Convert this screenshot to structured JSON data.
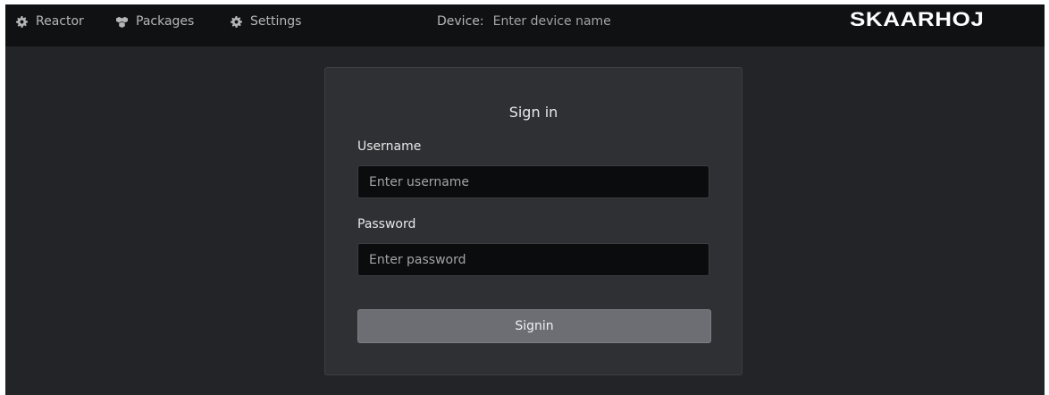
{
  "topbar": {
    "nav": [
      {
        "label": "Reactor",
        "icon": "gear-icon"
      },
      {
        "label": "Packages",
        "icon": "packages-icon"
      },
      {
        "label": "Settings",
        "icon": "gear-icon"
      }
    ],
    "device_label": "Device:",
    "device_placeholder": "Enter device name",
    "logo": "SKAARHOJ"
  },
  "login": {
    "title": "Sign in",
    "username_label": "Username",
    "username_placeholder": "Enter username",
    "username_value": "",
    "password_label": "Password",
    "password_placeholder": "Enter password",
    "password_value": "",
    "button_label": "Signin"
  },
  "colors": {
    "background": "#232427",
    "topbar": "#101113",
    "card": "#2f3033",
    "input": "#0b0c0d",
    "button": "#6c6e73",
    "logo": "#ffffff"
  }
}
